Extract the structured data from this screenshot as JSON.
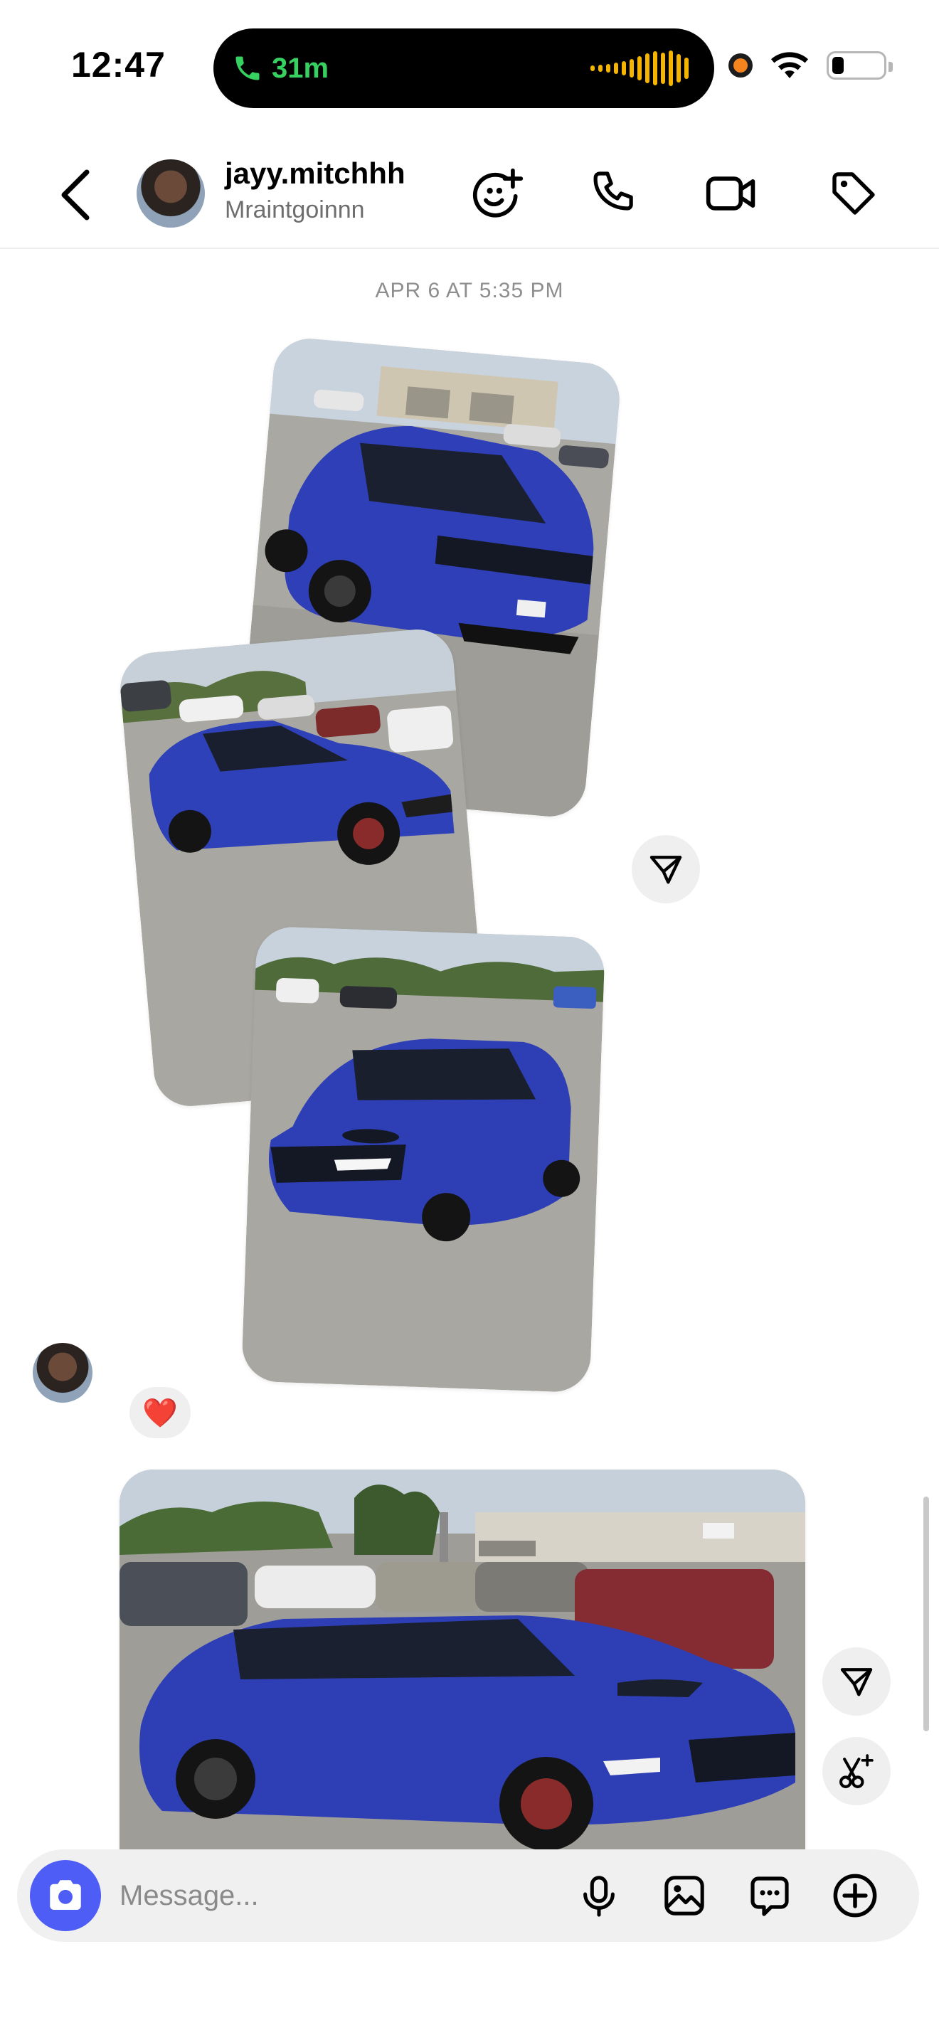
{
  "status_bar": {
    "time": "12:47",
    "call_duration": "31m",
    "call_color": "#36d160"
  },
  "header": {
    "username": "jayy.mitchhh",
    "display_name": "Mraintgoinnn"
  },
  "chat": {
    "date_stamp": "APR 6 AT 5:35 PM",
    "reaction": "❤️"
  },
  "composer": {
    "placeholder": "Message...",
    "accent": "#4e5df6"
  },
  "icons": [
    "back-chevron-icon",
    "add-effect-icon",
    "phone-icon",
    "video-icon",
    "tag-icon",
    "share-icon",
    "ai-edit-icon",
    "camera-icon",
    "microphone-icon",
    "gallery-icon",
    "sticker-icon",
    "plus-icon"
  ]
}
